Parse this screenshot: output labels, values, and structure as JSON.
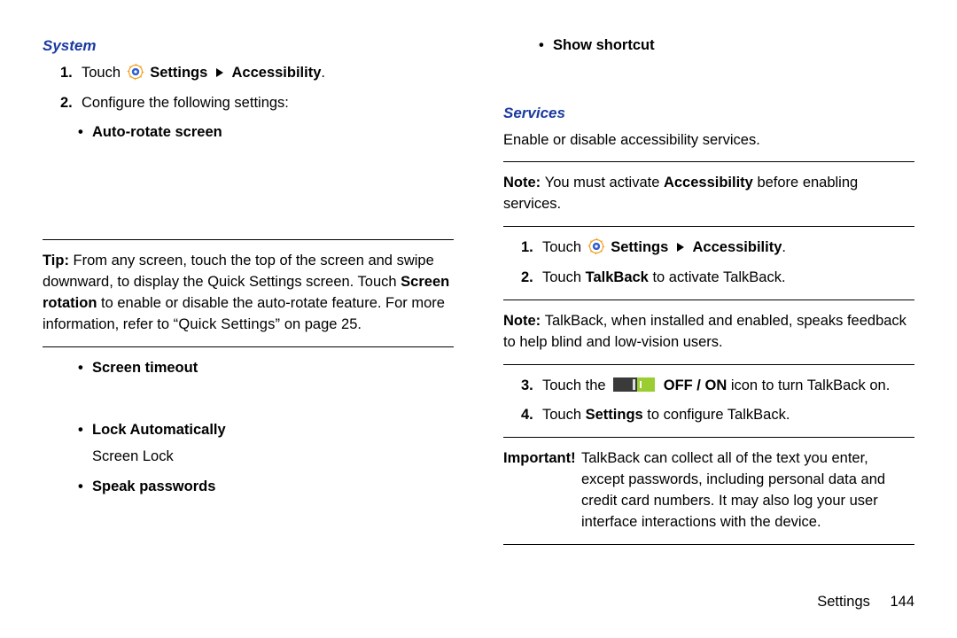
{
  "left": {
    "heading": "System",
    "step1_pre": "Touch ",
    "step1_settings": "Settings",
    "step1_arrow_then": "Accessibility",
    "step1_post": ".",
    "step2": "Configure the following settings:",
    "bullet_auto_rotate": "Auto-rotate screen",
    "tip_lead": "Tip: ",
    "tip_part1": "From any screen, touch the top of the screen and swipe downward, to display the Quick Settings screen. Touch ",
    "tip_bold": "Screen rotation",
    "tip_part2": " to enable or disable the auto-rotate feature. For more information, refer to ",
    "tip_link": "“Quick Settings”",
    "tip_part3": " on page 25.",
    "bullet_screen_timeout": "Screen timeout",
    "bullet_lock_auto": "Lock Automatically",
    "screen_lock": "Screen Lock",
    "bullet_speak_passwords": "Speak passwords"
  },
  "right": {
    "bullet_show_shortcut": "Show shortcut",
    "heading": "Services",
    "intro": "Enable or disable accessibility services.",
    "note1_lead": "Note: ",
    "note1_a": "You must activate ",
    "note1_bold": "Accessibility",
    "note1_b": " before enabling services.",
    "step1_pre": "Touch ",
    "step1_settings": "Settings",
    "step1_arrow_then": "Accessibility",
    "step1_post": ".",
    "step2_a": "Touch ",
    "step2_bold": "TalkBack",
    "step2_b": " to activate TalkBack.",
    "note2_lead": "Note: ",
    "note2_body": "TalkBack, when installed and enabled, speaks feedback to help blind and low-vision users.",
    "step3_a": "Touch the ",
    "step3_bold": "OFF / ON",
    "step3_b": " icon to turn TalkBack on.",
    "step4_a": "Touch ",
    "step4_bold": "Settings",
    "step4_b": " to configure TalkBack.",
    "important_lead": "Important! ",
    "important_body": "TalkBack can collect all of the text you enter, except passwords, including personal data and credit card numbers. It may also log your user interface interactions with the device."
  },
  "footer": {
    "section": "Settings",
    "page": "144"
  },
  "nums": {
    "n1": "1.",
    "n2": "2.",
    "n3": "3.",
    "n4": "4."
  },
  "marks": {
    "bullet": "•"
  }
}
